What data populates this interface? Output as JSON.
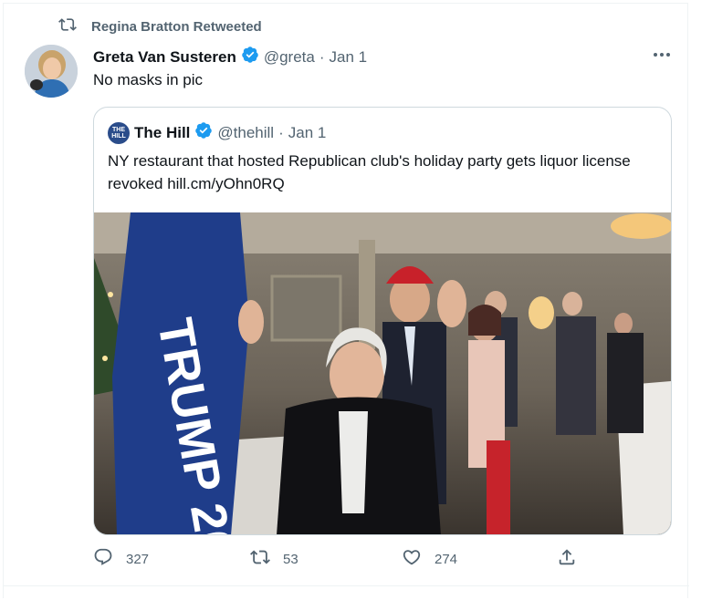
{
  "retweet": {
    "label": "Regina Bratton Retweeted",
    "icon": "retweet-icon"
  },
  "tweet": {
    "author_name": "Greta Van Susteren",
    "handle": "@greta",
    "separator": "·",
    "date": "Jan 1",
    "text": "No masks in pic",
    "verified_color": "#1d9bf0"
  },
  "quote": {
    "logo_text": "THE HILL",
    "author_name": "The Hill",
    "handle": "@thehill",
    "separator": "·",
    "date": "Jan 1",
    "text": "NY restaurant that hosted Republican club's holiday party gets liquor license revoked hill.cm/yOhn0RQ"
  },
  "actions": {
    "replies": "327",
    "retweets": "53",
    "likes": "274"
  },
  "colors": {
    "secondary_text": "#536471",
    "border": "#cfd9de",
    "accent": "#1d9bf0"
  }
}
